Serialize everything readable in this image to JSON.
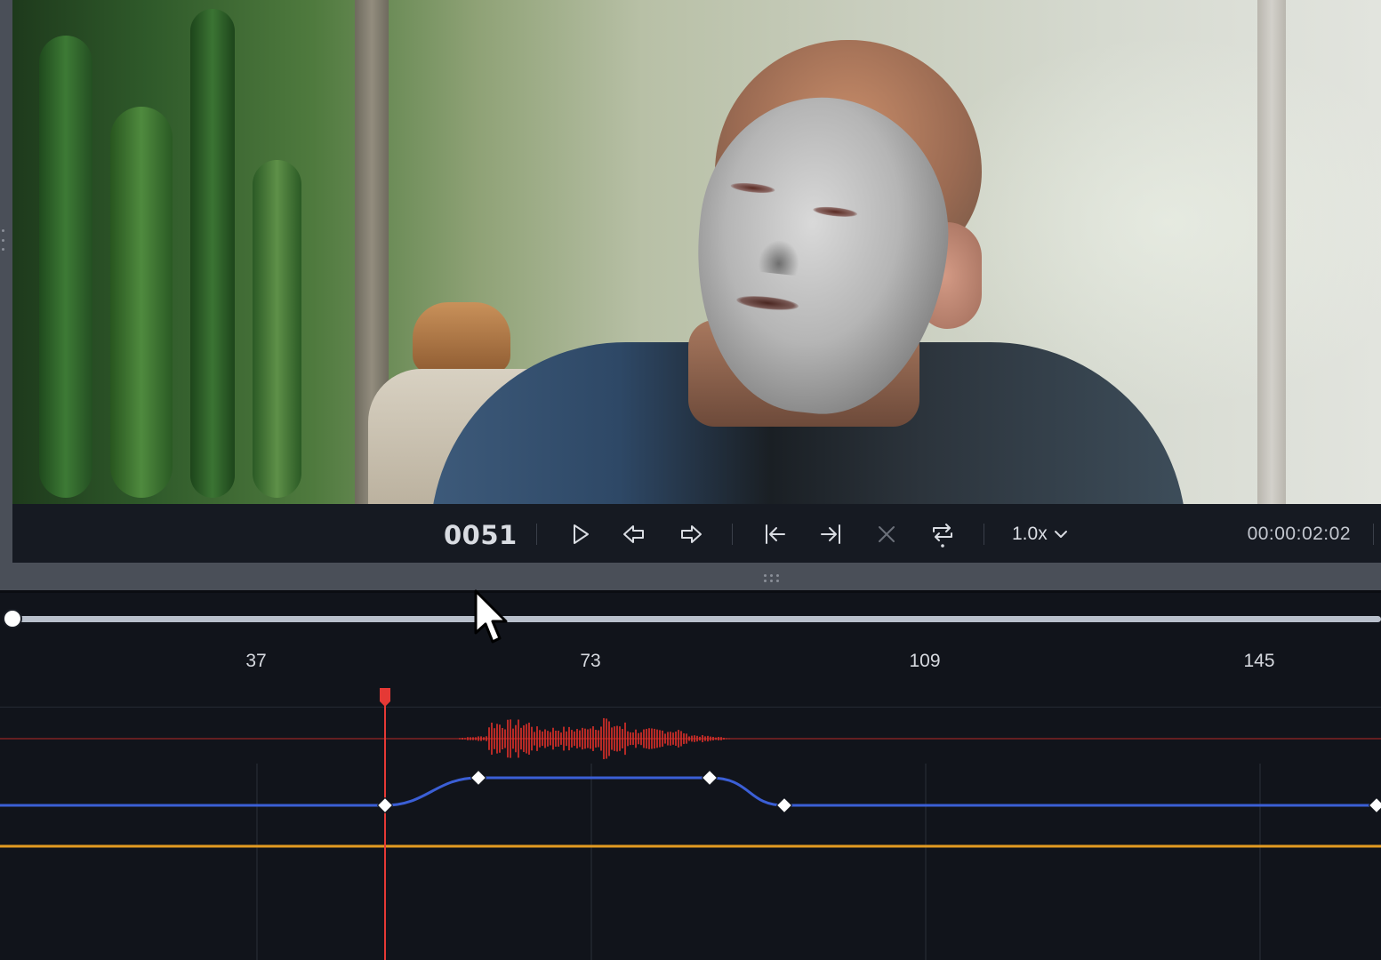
{
  "player": {
    "frame_counter": "0051",
    "timecode": "00:00:02:02",
    "speed": "1.0x"
  },
  "transport_icons": [
    "play-icon",
    "step-back-icon",
    "step-forward-icon",
    "jump-to-start-icon",
    "jump-to-end-icon",
    "clear-icon",
    "loop-icon",
    "chevron-down-icon"
  ],
  "timeline": {
    "ruler_labels": [
      "37",
      "73",
      "109",
      "145"
    ],
    "playhead_frame": 51,
    "scrub_position": 0,
    "colors": {
      "waveform": "#e0302a",
      "curve_blue": "#3b5fd6",
      "curve_orange": "#e39b22",
      "playhead": "#e53935",
      "keyframe": "#ffffff"
    },
    "keyframes_frames": [
      51,
      61,
      86,
      94,
      155
    ]
  }
}
